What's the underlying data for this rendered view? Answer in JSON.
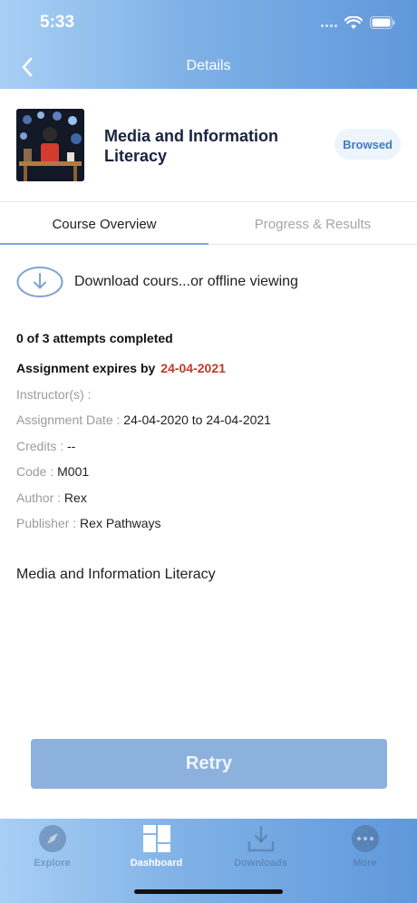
{
  "status_bar": {
    "time": "5:33"
  },
  "nav": {
    "title": "Details"
  },
  "course": {
    "title": "Media and Information Literacy",
    "badge": "Browsed"
  },
  "tabs": [
    {
      "label": "Course Overview",
      "active": true
    },
    {
      "label": "Progress & Results",
      "active": false
    }
  ],
  "download": {
    "label": "Download cours...or offline viewing"
  },
  "details": {
    "attempts": "0 of 3 attempts completed",
    "expires_label": "Assignment expires by",
    "expires_value": "24-04-2021",
    "instructor_label": "Instructor(s) :",
    "instructor_value": "",
    "assignment_date_label": "Assignment Date :",
    "assignment_date_value": "24-04-2020 to 24-04-2021",
    "credits_label": "Credits :",
    "credits_value": "--",
    "code_label": "Code :",
    "code_value": "M001",
    "author_label": "Author :",
    "author_value": "Rex",
    "publisher_label": "Publisher :",
    "publisher_value": "Rex Pathways"
  },
  "description": "Media and Information Literacy",
  "retry_button": "Retry",
  "tabbar": [
    {
      "label": "Explore",
      "icon": "compass-icon"
    },
    {
      "label": "Dashboard",
      "icon": "dashboard-icon",
      "active": true
    },
    {
      "label": "Downloads",
      "icon": "download-icon"
    },
    {
      "label": "More",
      "icon": "more-icon"
    }
  ],
  "colors": {
    "header_gradient_start": "#a8cff5",
    "header_gradient_end": "#5f98db",
    "accent": "#3f79c4",
    "expiry": "#c0392b",
    "retry_bg": "#8db1dd"
  }
}
